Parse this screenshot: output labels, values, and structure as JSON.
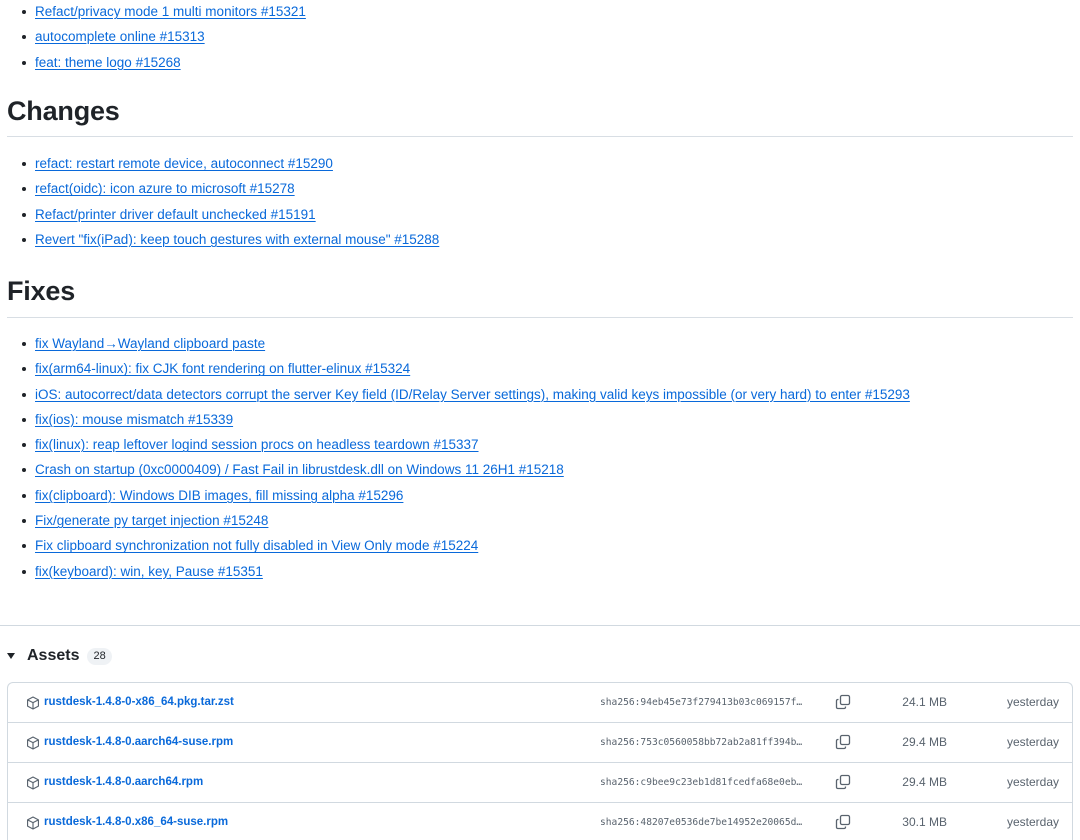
{
  "top_items": [
    {
      "text": "Refact/privacy mode 1 multi monitors #15321"
    },
    {
      "text": "autocomplete online #15313"
    },
    {
      "text": "feat: theme logo #15268"
    }
  ],
  "changes": {
    "heading": "Changes",
    "items": [
      {
        "text": "refact: restart remote device, autoconnect #15290"
      },
      {
        "text": "refact(oidc): icon azure to microsoft #15278"
      },
      {
        "text": "Refact/printer driver default unchecked #15191"
      },
      {
        "text": "Revert \"fix(iPad): keep touch gestures with external mouse\" #15288"
      }
    ]
  },
  "fixes": {
    "heading": "Fixes",
    "items": [
      {
        "text": "fix Wayland→Wayland clipboard paste"
      },
      {
        "text": "fix(arm64-linux): fix CJK font rendering on flutter-elinux #15324"
      },
      {
        "text": "iOS: autocorrect/data detectors corrupt the server Key field (ID/Relay Server settings), making valid keys impossible (or very hard) to enter #15293"
      },
      {
        "text": "fix(ios): mouse mismatch #15339"
      },
      {
        "text": "fix(linux): reap leftover logind session procs on headless teardown #15337"
      },
      {
        "text": "Crash on startup (0xc0000409) / Fast Fail in librustdesk.dll on Windows 11 26H1 #15218"
      },
      {
        "text": "fix(clipboard): Windows DIB images, fill missing alpha #15296"
      },
      {
        "text": "Fix/generate py target injection #15248"
      },
      {
        "text": "Fix clipboard synchronization not fully disabled in View Only mode #15224"
      },
      {
        "text": "fix(keyboard): win, key, Pause #15351"
      }
    ]
  },
  "assets": {
    "label": "Assets",
    "count": "28",
    "rows": [
      {
        "name": "rustdesk-1.4.8-0-x86_64.pkg.tar.zst",
        "sha": "sha256:94eb45e73f279413b03c069157f…",
        "size": "24.1 MB",
        "date": "yesterday"
      },
      {
        "name": "rustdesk-1.4.8-0.aarch64-suse.rpm",
        "sha": "sha256:753c0560058bb72ab2a81ff394b…",
        "size": "29.4 MB",
        "date": "yesterday"
      },
      {
        "name": "rustdesk-1.4.8-0.aarch64.rpm",
        "sha": "sha256:c9bee9c23eb1d81fcedfa68e0eb…",
        "size": "29.4 MB",
        "date": "yesterday"
      },
      {
        "name": "rustdesk-1.4.8-0.x86_64-suse.rpm",
        "sha": "sha256:48207e0536de7be14952e20065d…",
        "size": "30.1 MB",
        "date": "yesterday"
      }
    ]
  },
  "colors": {
    "link": "#0969da",
    "text": "#1f2328",
    "muted": "#59636e",
    "border": "#d1d9e0"
  },
  "icons": {
    "package": "package-icon",
    "copy": "copy-icon",
    "caret": "triangle-down-icon"
  }
}
